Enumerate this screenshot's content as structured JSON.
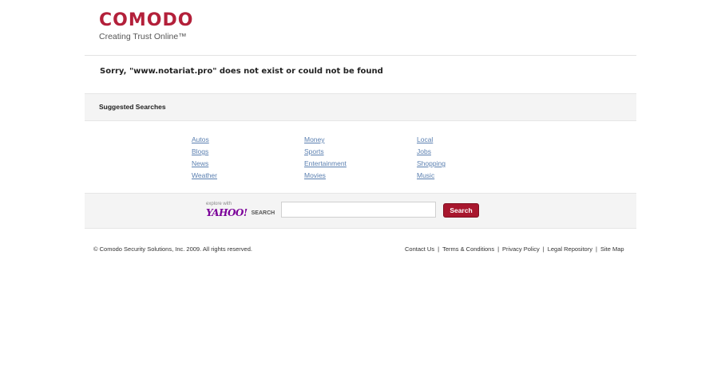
{
  "logo": {
    "name": "COMODO",
    "tagline": "Creating Trust Online™"
  },
  "error": {
    "message": "Sorry, \"www.notariat.pro\" does not exist or could not be found"
  },
  "suggested": {
    "title": "Suggested Searches",
    "columns": [
      [
        "Autos",
        "Blogs",
        "News",
        "Weather"
      ],
      [
        "Money",
        "Sports",
        "Entertainment",
        "Movies"
      ],
      [
        "Local",
        "Jobs",
        "Shopping",
        "Music"
      ]
    ]
  },
  "search": {
    "explore_text": "explore with",
    "yahoo_logo": "YAHOO!",
    "search_label": "SEARCH",
    "input_value": "",
    "button_label": "Search"
  },
  "footer": {
    "copyright": "© Comodo Security Solutions, Inc. 2009. All rights reserved.",
    "links": [
      "Contact Us",
      "Terms & Conditions",
      "Privacy Policy",
      "Legal Repository",
      "Site Map"
    ]
  },
  "colors": {
    "brand": "#b3203a",
    "link": "#5a7fb0",
    "button": "#a8172e"
  }
}
